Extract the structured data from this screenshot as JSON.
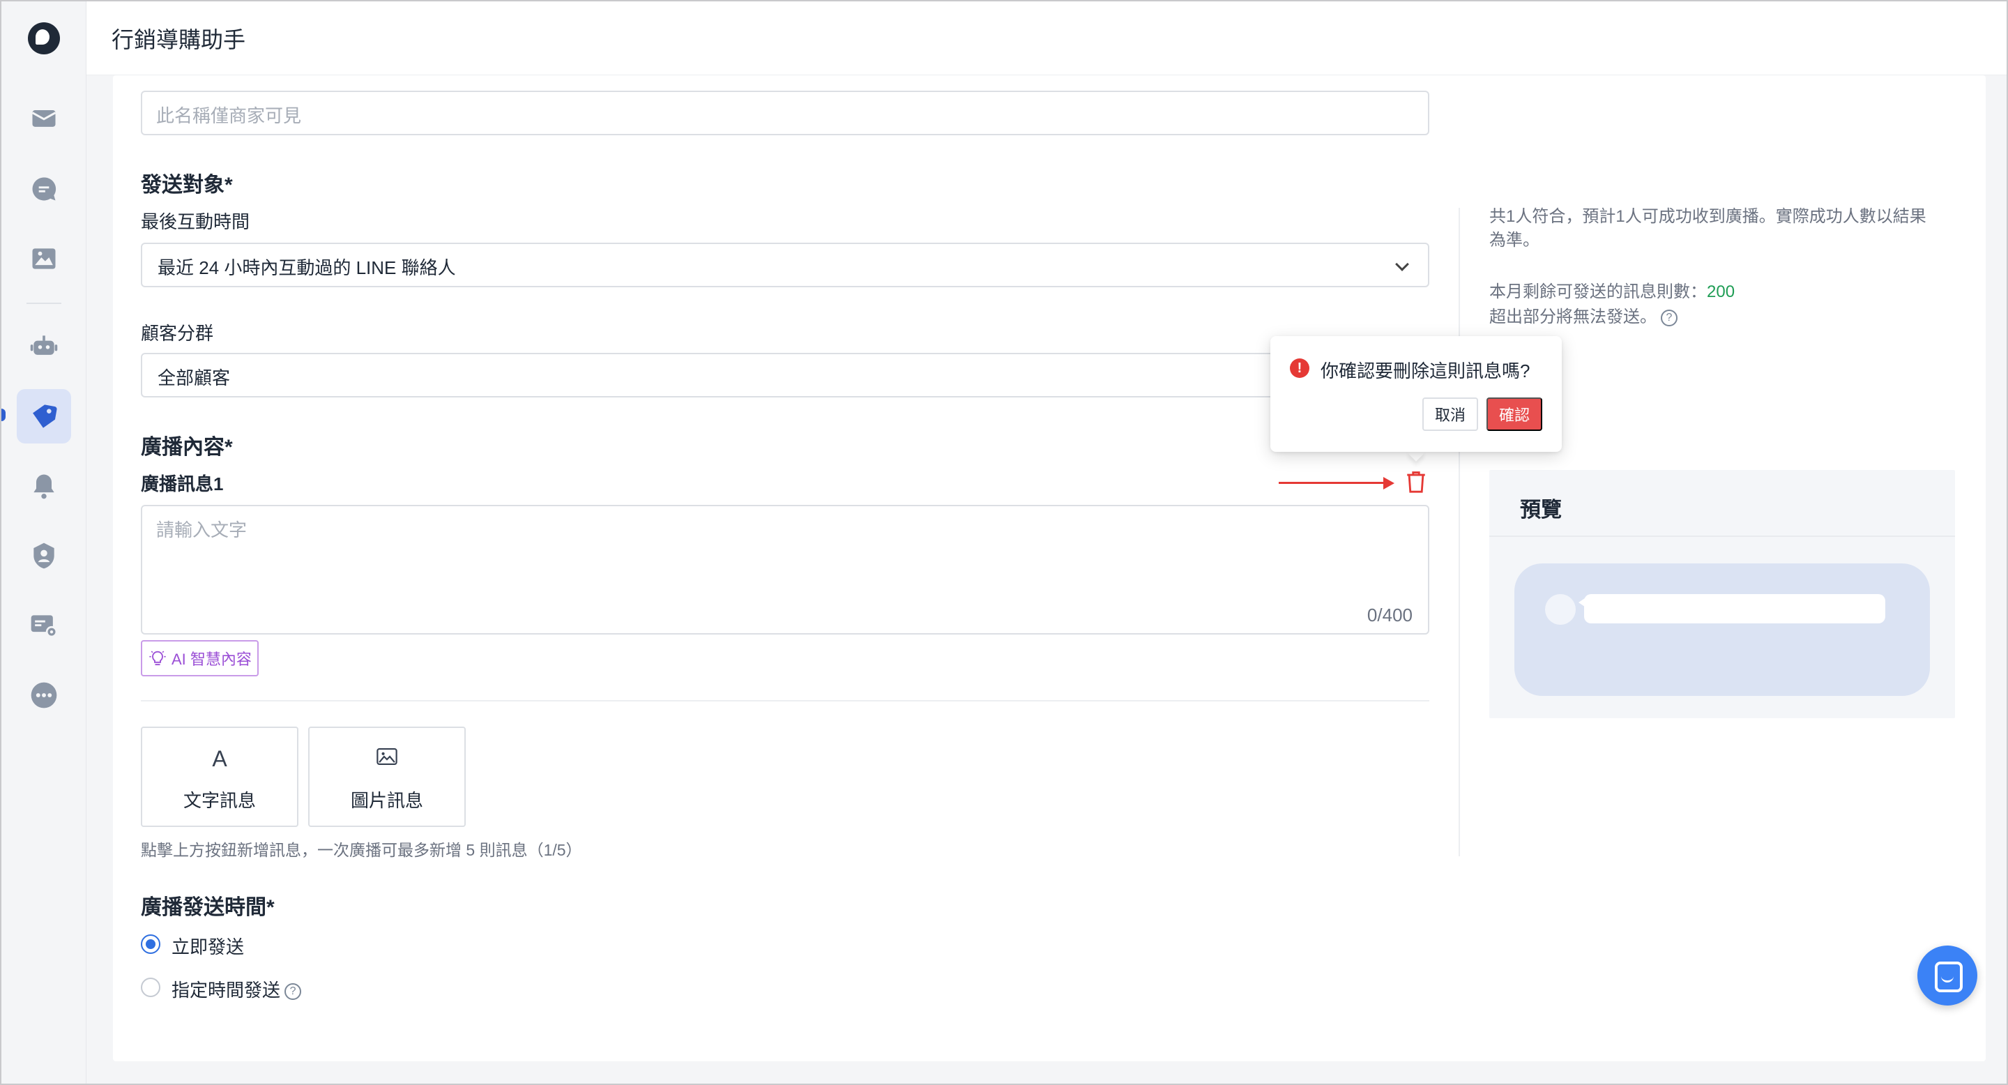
{
  "app": {
    "title": "行銷導購助手"
  },
  "sidebar": {
    "items": [
      {
        "icon": "logo-icon"
      },
      {
        "icon": "mail-icon"
      },
      {
        "icon": "chat-bubble-icon"
      },
      {
        "icon": "image-icon"
      },
      {
        "icon": "bot-icon"
      },
      {
        "icon": "tag-icon",
        "active": true
      },
      {
        "icon": "bell-icon"
      },
      {
        "icon": "user-shield-icon"
      },
      {
        "icon": "message-settings-icon"
      },
      {
        "icon": "more-icon"
      }
    ],
    "accent_color": "#2f5fd0"
  },
  "form": {
    "name_placeholder": "此名稱僅商家可見",
    "audience_title": "發送對象*",
    "last_interaction_label": "最後互動時間",
    "last_interaction_value": "最近 24 小時內互動過的 LINE 聯絡人",
    "segment_label": "顧客分群",
    "segment_value": "全部顧客",
    "content_title": "廣播內容*",
    "message_label": "廣播訊息1",
    "message_placeholder": "請輸入文字",
    "message_counter": "0/400",
    "ai_button_label": "AI 智慧內容",
    "text_msg_label": "文字訊息",
    "text_msg_icon": "A",
    "image_msg_label": "圖片訊息",
    "add_hint": "點擊上方按鈕新增訊息，一次廣播可最多新增 5 則訊息（1/5）",
    "send_time_title": "廣播發送時間*",
    "send_now_label": "立即發送",
    "send_scheduled_label": "指定時間發送"
  },
  "info": {
    "match_text": "共1人符合，預計1人可成功收到廣播。實際成功人數以結果為準。",
    "remaining_label": "本月剩餘可發送的訊息則數：",
    "remaining_value": "200",
    "over_limit_text": "超出部分將無法發送。"
  },
  "preview": {
    "title": "預覽"
  },
  "popconfirm": {
    "message": "你確認要刪除這則訊息嗎?",
    "cancel_label": "取消",
    "confirm_label": "確認",
    "warn_glyph": "!"
  },
  "colors": {
    "danger": "#e84f4f",
    "primary": "#2f6fe0",
    "ai_purple": "#9b4fd6",
    "success": "#1f9d55"
  }
}
